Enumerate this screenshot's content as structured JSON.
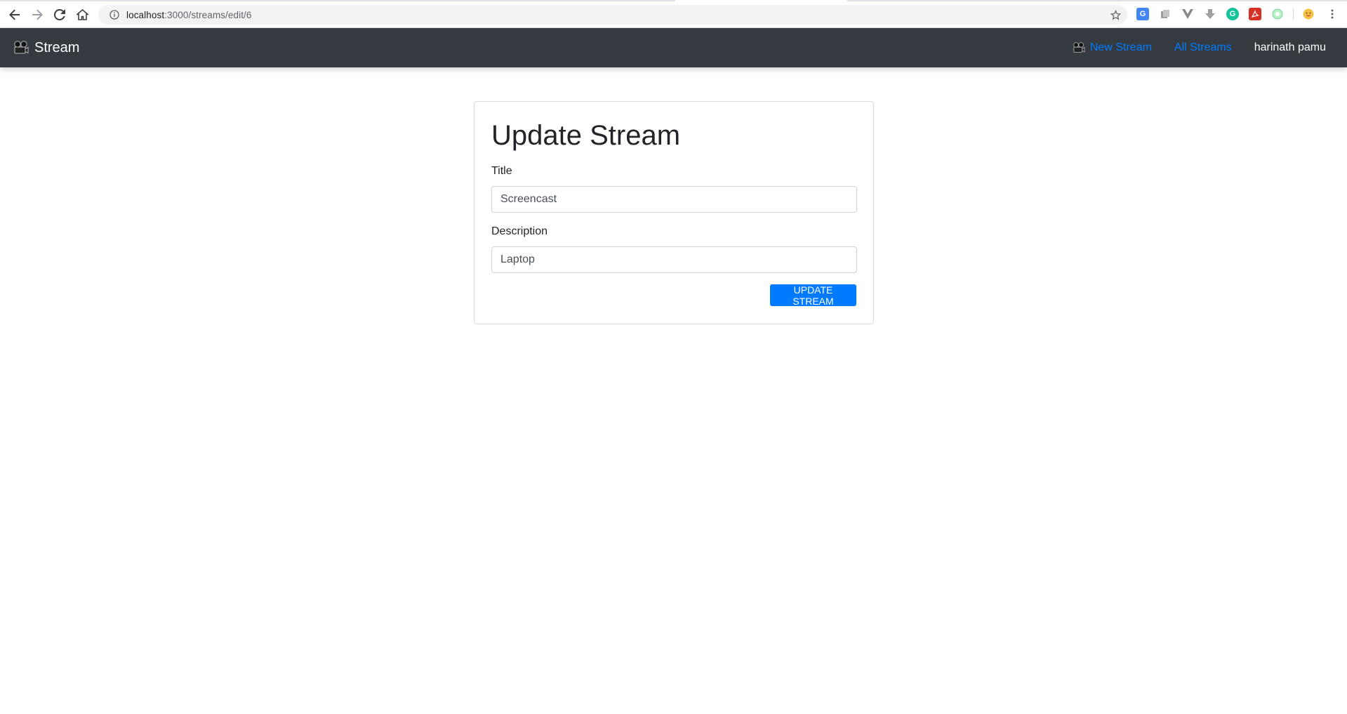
{
  "browser": {
    "url_host": "localhost",
    "url_path": ":3000/streams/edit/6",
    "icons": {
      "back": "arrow-left-icon",
      "forward": "arrow-right-icon",
      "reload": "reload-icon",
      "home": "home-icon",
      "info": "info-icon",
      "bookmark": "star-icon",
      "menu": "kebab-menu-icon"
    },
    "extensions": [
      "translate-extension-icon",
      "copy-extension-icon",
      "vue-extension-icon",
      "download-extension-icon",
      "grammarly-extension-icon",
      "pdf-extension-icon",
      "coloring-extension-icon",
      "emoji-extension-icon"
    ]
  },
  "navbar": {
    "brand_label": "Stream",
    "new_stream_label": "New Stream",
    "all_streams_label": "All Streams",
    "user_label": "harinath pamu",
    "brand_color": "#343a40",
    "link_color": "#007bff"
  },
  "form": {
    "heading": "Update Stream",
    "title_label": "Title",
    "title_value": "Screencast",
    "description_label": "Description",
    "description_value": "Laptop",
    "submit_label": "UPDATE STREAM",
    "accent_color": "#007bff"
  }
}
